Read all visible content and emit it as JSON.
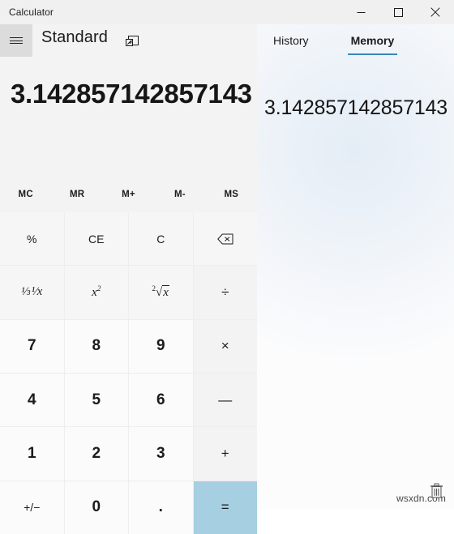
{
  "window": {
    "title": "Calculator",
    "controls": [
      {
        "name": "minimize",
        "glyph": "minimize-icon"
      },
      {
        "name": "maximize",
        "glyph": "maximize-icon"
      },
      {
        "name": "close",
        "glyph": "close-icon"
      }
    ]
  },
  "nav": {
    "menu_icon": "hamburger-icon",
    "mode_title": "Standard",
    "keep_on_top_icon": "keep-on-top-icon"
  },
  "display": {
    "value": "3.142857142857143"
  },
  "memory_buttons": [
    {
      "label": "MC",
      "name": "memory-clear"
    },
    {
      "label": "MR",
      "name": "memory-recall"
    },
    {
      "label": "M+",
      "name": "memory-add"
    },
    {
      "label": "M-",
      "name": "memory-subtract"
    },
    {
      "label": "MS",
      "name": "memory-store"
    }
  ],
  "keypad": {
    "rows": [
      [
        {
          "label": "%",
          "name": "percent",
          "kind": "fn"
        },
        {
          "label": "CE",
          "name": "clear-entry",
          "kind": "fn"
        },
        {
          "label": "C",
          "name": "clear",
          "kind": "fn"
        },
        {
          "label": "",
          "name": "backspace",
          "kind": "fn",
          "icon": "backspace-icon"
        }
      ],
      [
        {
          "label": "",
          "name": "reciprocal",
          "kind": "fn",
          "math": "one-over-x"
        },
        {
          "label": "",
          "name": "square",
          "kind": "fn",
          "math": "x-squared"
        },
        {
          "label": "",
          "name": "square-root",
          "kind": "fn",
          "math": "square-root-of-x"
        },
        {
          "label": "÷",
          "name": "divide",
          "kind": "op"
        }
      ],
      [
        {
          "label": "7",
          "name": "seven",
          "kind": "num"
        },
        {
          "label": "8",
          "name": "eight",
          "kind": "num"
        },
        {
          "label": "9",
          "name": "nine",
          "kind": "num"
        },
        {
          "label": "×",
          "name": "multiply",
          "kind": "op"
        }
      ],
      [
        {
          "label": "4",
          "name": "four",
          "kind": "num"
        },
        {
          "label": "5",
          "name": "five",
          "kind": "num"
        },
        {
          "label": "6",
          "name": "six",
          "kind": "num"
        },
        {
          "label": "—",
          "name": "subtract",
          "kind": "op"
        }
      ],
      [
        {
          "label": "1",
          "name": "one",
          "kind": "num"
        },
        {
          "label": "2",
          "name": "two",
          "kind": "num"
        },
        {
          "label": "3",
          "name": "three",
          "kind": "num"
        },
        {
          "label": "+",
          "name": "add",
          "kind": "op"
        }
      ],
      [
        {
          "label": "+/−",
          "name": "negate",
          "kind": "num"
        },
        {
          "label": "0",
          "name": "zero",
          "kind": "num"
        },
        {
          "label": ".",
          "name": "decimal",
          "kind": "num"
        },
        {
          "label": "=",
          "name": "equals",
          "kind": "equals"
        }
      ]
    ]
  },
  "side_panel": {
    "tabs": [
      {
        "label": "History",
        "selected": false
      },
      {
        "label": "Memory",
        "selected": true
      }
    ],
    "memory_value": "3.142857142857143"
  },
  "watermark": {
    "text": "wsxdn.com",
    "icon": "trash-icon"
  },
  "colors": {
    "accent": "#3a87b8",
    "equals_button": "#a6cfe2",
    "titlebar": "#f0f0f0",
    "keypad_bg": "#f3f3f3"
  }
}
